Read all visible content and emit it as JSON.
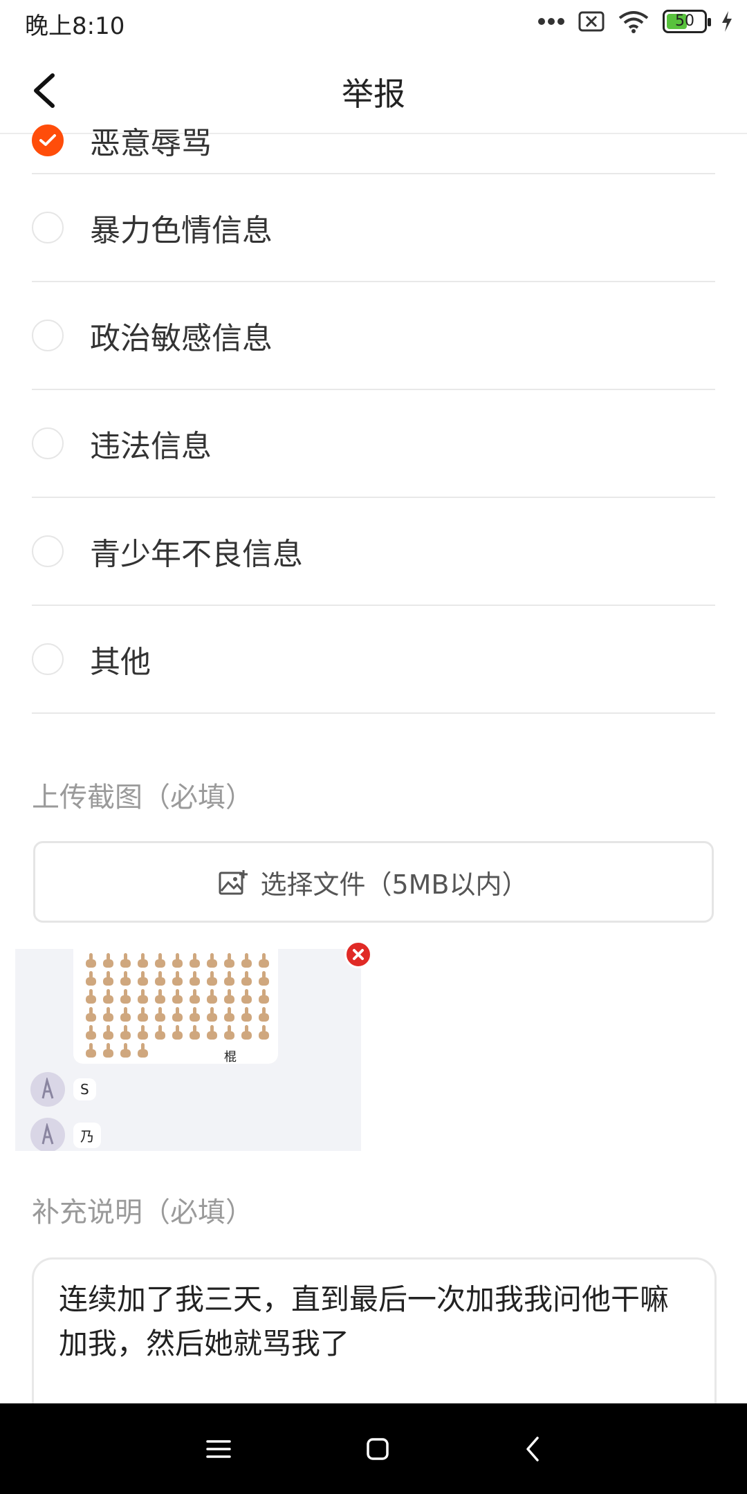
{
  "status": {
    "time": "晚上8:10",
    "battery": "50"
  },
  "header": {
    "title": "举报"
  },
  "report_reasons": [
    {
      "label": "恶意辱骂",
      "checked": true
    },
    {
      "label": "暴力色情信息",
      "checked": false
    },
    {
      "label": "政治敏感信息",
      "checked": false
    },
    {
      "label": "违法信息",
      "checked": false
    },
    {
      "label": "青少年不良信息",
      "checked": false
    },
    {
      "label": "其他",
      "checked": false
    }
  ],
  "upload": {
    "section_label": "上传截图（必填）",
    "button_label": "选择文件（5MB以内）"
  },
  "screenshot_preview": {
    "emoji_caption": "棍",
    "messages": [
      "S",
      "乃"
    ]
  },
  "description": {
    "section_label": "补充说明（必填）",
    "value": "连续加了我三天，直到最后一次加我我问他干嘛加我，然后她就骂我了"
  },
  "colors": {
    "accent": "#ff4d0a",
    "remove": "#e02a26"
  }
}
